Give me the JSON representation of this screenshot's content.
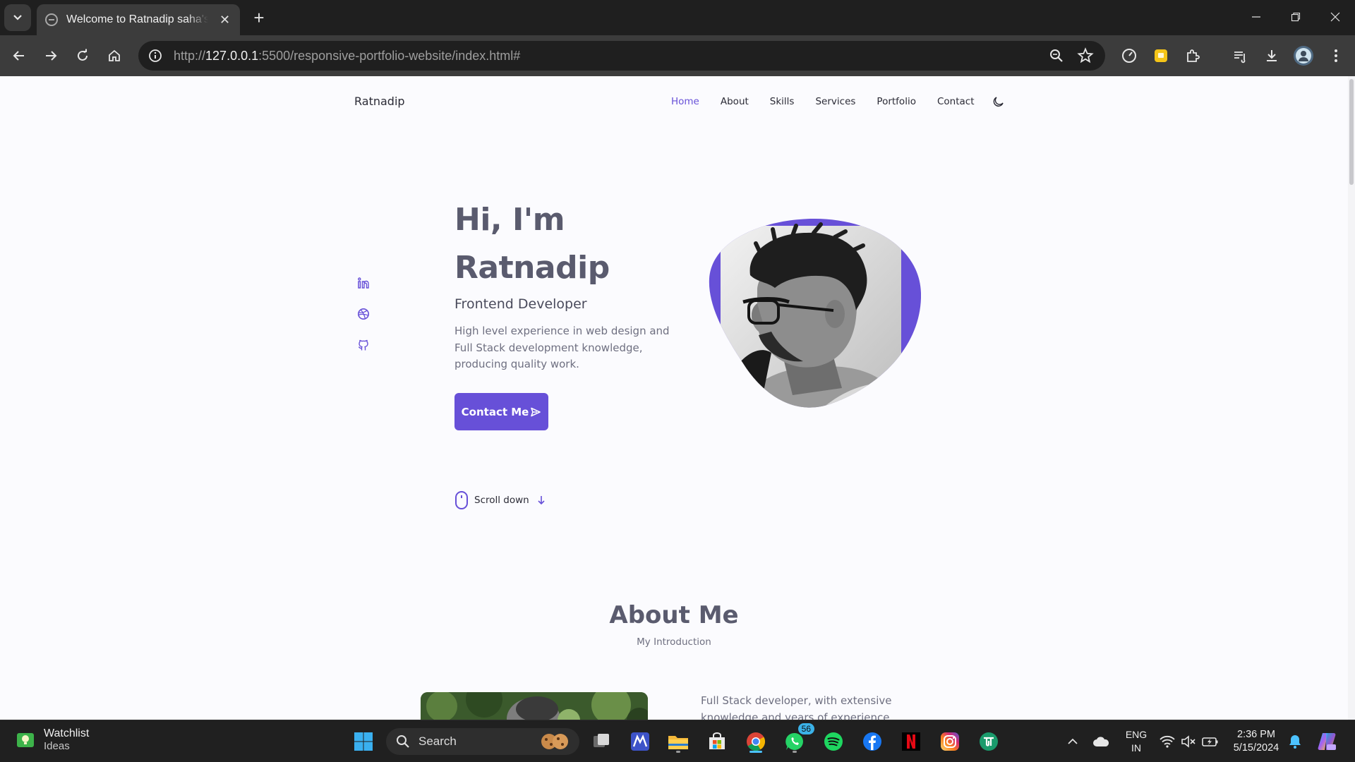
{
  "browser": {
    "tab_title": "Welcome to Ratnadip saha's portfolio",
    "tab_close": "✕",
    "new_tab": "+",
    "url_prefix": "http://",
    "url_host": "127.0.0.1",
    "url_rest": ":5500/responsive-portfolio-website/index.html#"
  },
  "nav": {
    "logo": "Ratnadip",
    "links": [
      "Home",
      "About",
      "Skills",
      "Services",
      "Portfolio",
      "Contact"
    ],
    "active": "Home"
  },
  "hero": {
    "title_line1": "Hi, I'm",
    "title_line2": "Ratnadip",
    "subtitle": "Frontend Developer",
    "description": "High level experience in web design and Full Stack development knowledge, producing quality work.",
    "button_label": "Contact Me",
    "scroll_label": "Scroll down",
    "social": [
      "linkedin-icon",
      "dribbble-icon",
      "github-icon"
    ]
  },
  "about": {
    "title": "About Me",
    "subtitle": "My Introduction",
    "text": "Full Stack developer, with extensive knowledge and years of experience,"
  },
  "taskbar": {
    "widget_title": "Watchlist",
    "widget_sub": "Ideas",
    "search_label": "Search",
    "whatsapp_badge": "56",
    "lang_line1": "ENG",
    "lang_line2": "IN",
    "time": "2:36 PM",
    "date": "5/15/2024"
  },
  "colors": {
    "accent": "#6750d8",
    "title_text": "#5a5b6e",
    "page_bg": "#fbfbfe"
  }
}
